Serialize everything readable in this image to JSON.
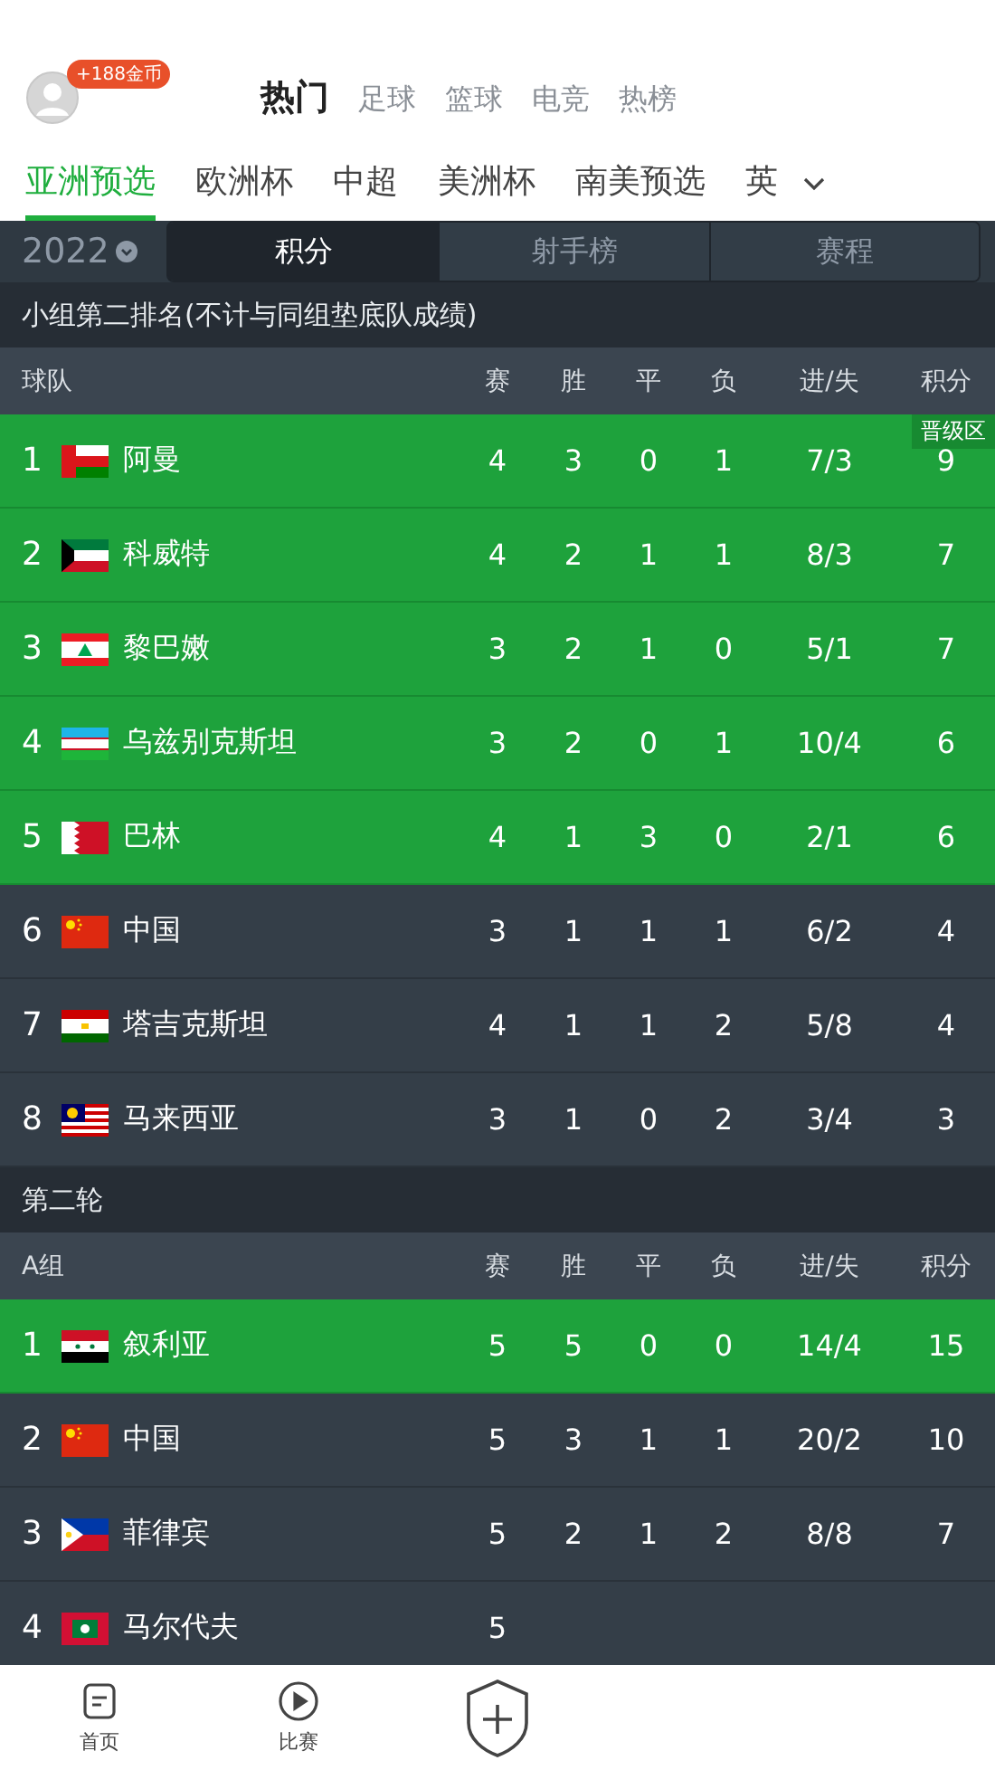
{
  "header": {
    "coins_badge": "+188金币",
    "categories": [
      {
        "label": "热门",
        "selected": true
      },
      {
        "label": "足球",
        "selected": false
      },
      {
        "label": "篮球",
        "selected": false
      },
      {
        "label": "电竞",
        "selected": false
      },
      {
        "label": "热榜",
        "selected": false
      }
    ]
  },
  "league_tabs": [
    {
      "label": "亚洲预选",
      "selected": true
    },
    {
      "label": "欧洲杯",
      "selected": false
    },
    {
      "label": "中超",
      "selected": false
    },
    {
      "label": "美洲杯",
      "selected": false
    },
    {
      "label": "南美预选",
      "selected": false
    },
    {
      "label": "英",
      "selected": false
    }
  ],
  "season": "2022",
  "segments": [
    {
      "label": "积分",
      "selected": true
    },
    {
      "label": "射手榜",
      "selected": false
    },
    {
      "label": "赛程",
      "selected": false
    }
  ],
  "sections": [
    {
      "title": "小组第二排名(不计与同组垫底队成绩)",
      "team_header": "球队",
      "stat_headers": [
        "赛",
        "胜",
        "平",
        "负",
        "进/失",
        "积分"
      ],
      "rows": [
        {
          "rank": "1",
          "flag": {
            "kind": "oman"
          },
          "team": "阿曼",
          "stats": [
            "4",
            "3",
            "0",
            "1",
            "7/3",
            "9"
          ],
          "qualified": true,
          "tag": "晋级区"
        },
        {
          "rank": "2",
          "flag": {
            "kind": "kuwait"
          },
          "team": "科威特",
          "stats": [
            "4",
            "2",
            "1",
            "1",
            "8/3",
            "7"
          ],
          "qualified": true
        },
        {
          "rank": "3",
          "flag": {
            "kind": "lebanon"
          },
          "team": "黎巴嫩",
          "stats": [
            "3",
            "2",
            "1",
            "0",
            "5/1",
            "7"
          ],
          "qualified": true
        },
        {
          "rank": "4",
          "flag": {
            "kind": "uzbekistan"
          },
          "team": "乌兹别克斯坦",
          "stats": [
            "3",
            "2",
            "0",
            "1",
            "10/4",
            "6"
          ],
          "qualified": true
        },
        {
          "rank": "5",
          "flag": {
            "kind": "bahrain"
          },
          "team": "巴林",
          "stats": [
            "4",
            "1",
            "3",
            "0",
            "2/1",
            "6"
          ],
          "qualified": true
        },
        {
          "rank": "6",
          "flag": {
            "kind": "china"
          },
          "team": "中国",
          "stats": [
            "3",
            "1",
            "1",
            "1",
            "6/2",
            "4"
          ],
          "qualified": false
        },
        {
          "rank": "7",
          "flag": {
            "kind": "tajikistan"
          },
          "team": "塔吉克斯坦",
          "stats": [
            "4",
            "1",
            "1",
            "2",
            "5/8",
            "4"
          ],
          "qualified": false
        },
        {
          "rank": "8",
          "flag": {
            "kind": "malaysia"
          },
          "team": "马来西亚",
          "stats": [
            "3",
            "1",
            "0",
            "2",
            "3/4",
            "3"
          ],
          "qualified": false
        }
      ]
    },
    {
      "title": "第二轮",
      "team_header": "A组",
      "stat_headers": [
        "赛",
        "胜",
        "平",
        "负",
        "进/失",
        "积分"
      ],
      "rows": [
        {
          "rank": "1",
          "flag": {
            "kind": "syria"
          },
          "team": "叙利亚",
          "stats": [
            "5",
            "5",
            "0",
            "0",
            "14/4",
            "15"
          ],
          "qualified": true
        },
        {
          "rank": "2",
          "flag": {
            "kind": "china"
          },
          "team": "中国",
          "stats": [
            "5",
            "3",
            "1",
            "1",
            "20/2",
            "10"
          ],
          "qualified": false
        },
        {
          "rank": "3",
          "flag": {
            "kind": "philippines"
          },
          "team": "菲律宾",
          "stats": [
            "5",
            "2",
            "1",
            "2",
            "8/8",
            "7"
          ],
          "qualified": false
        },
        {
          "rank": "4",
          "flag": {
            "kind": "maldives"
          },
          "team": "马尔代夫",
          "stats": [
            "5"
          ],
          "qualified": false
        }
      ]
    }
  ],
  "bottom_nav": [
    {
      "kind": "home",
      "label": "首页"
    },
    {
      "kind": "match",
      "label": "比赛"
    },
    {
      "kind": "add"
    }
  ]
}
